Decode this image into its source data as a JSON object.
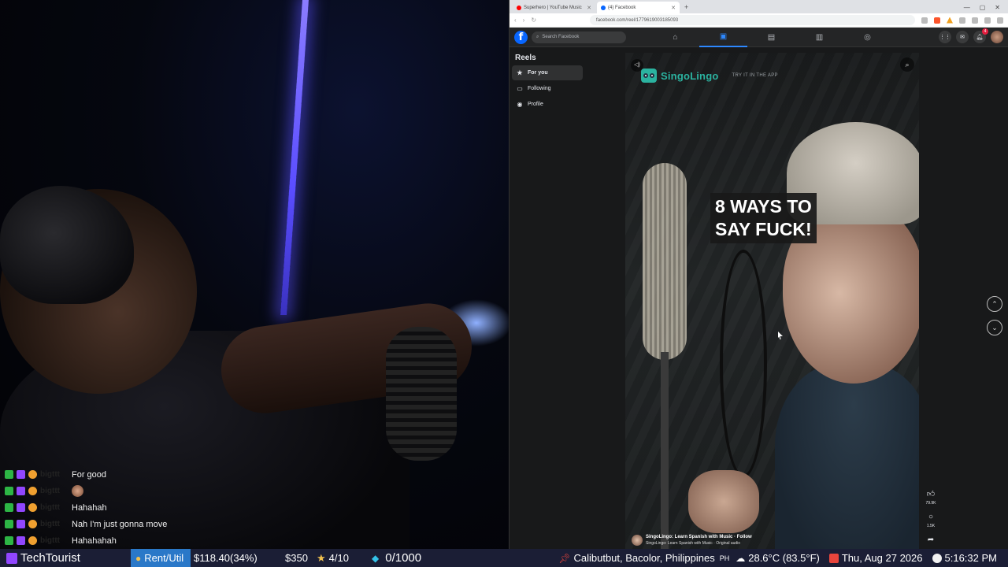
{
  "chat": {
    "lines": [
      {
        "user": "bigttt",
        "message": "For good"
      },
      {
        "user": "bigttt",
        "message": ""
      },
      {
        "user": "bigttt",
        "message": "Hahahah"
      },
      {
        "user": "bigttt",
        "message": "Nah I'm just gonna move"
      },
      {
        "user": "bigttt",
        "message": "Hahahahah"
      }
    ]
  },
  "browser": {
    "tabs": [
      {
        "title": "Superhero | YouTube Music",
        "color": "#ff0000"
      },
      {
        "title": "(4) Facebook",
        "color": "#0866ff"
      }
    ],
    "new_tab": "+",
    "url": "facebook.com/reel/1779619003185093"
  },
  "facebook": {
    "logo": "f",
    "search_placeholder": "Search Facebook",
    "notification_count": "4",
    "nav_icons": [
      "home-icon",
      "reels-icon",
      "marketplace-icon",
      "store-icon",
      "groups-icon"
    ],
    "sidebar": {
      "title": "Reels",
      "items": [
        {
          "label": "For you",
          "icon": "star-icon",
          "active": true
        },
        {
          "label": "Following",
          "icon": "following-icon",
          "active": false
        },
        {
          "label": "Profile",
          "icon": "profile-icon",
          "active": false
        }
      ]
    },
    "reel": {
      "brand_name": "SingoLingo",
      "brand_cta": "TRY IT IN THE APP",
      "caption": "8 WAYS TO\nSAY FUCK!",
      "author": "SingoLingo: Learn Spanish with Music · Follow",
      "audio": "SingoLingo: Learn Spanish with Music · Original audio",
      "likes": "79.9K",
      "comments": "1.5K"
    }
  },
  "ticker": {
    "channel": "TechTourist",
    "rent_label": "Rent/Util",
    "rent_amount": "$118.40(34%)",
    "rent_goal": "$350",
    "stars": "4/10",
    "gems": "0/1000",
    "location": "Calibutbut, Bacolor, Philippines",
    "location_tag": "PH",
    "weather": "28.6°C (83.5°F)",
    "date": "Thu, Aug 27 2026",
    "time": "5:16:32 PM"
  }
}
